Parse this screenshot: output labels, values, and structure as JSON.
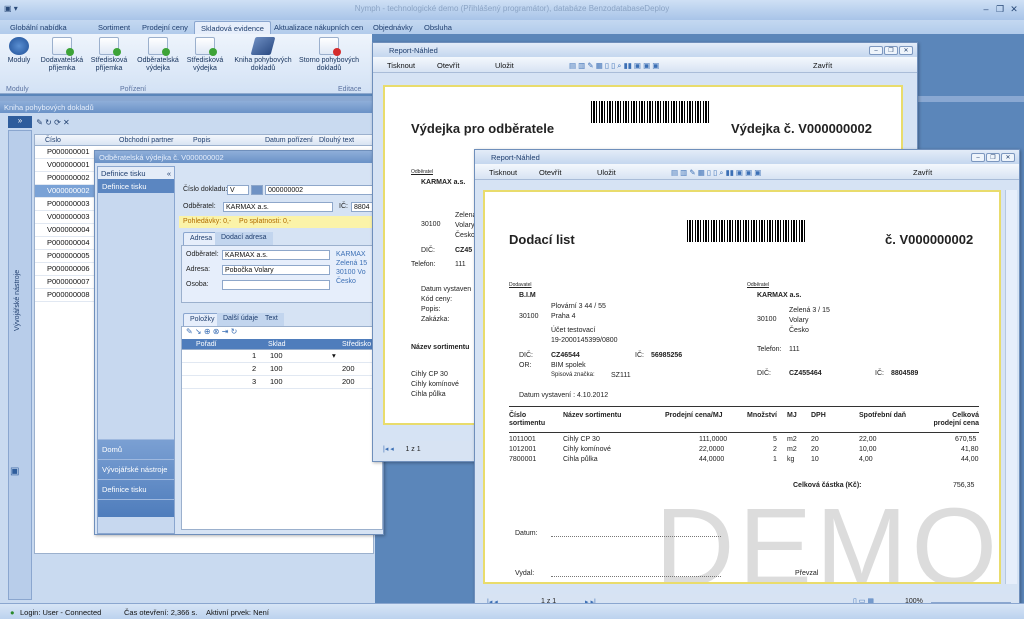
{
  "app": {
    "title": "Nymph - technologické demo (Přihlášený programátor), databáze BenzodatabaseDeploy"
  },
  "tabs": [
    "Globální nabídka",
    "Sortiment",
    "Prodejní ceny",
    "Skladová evidence",
    "Aktualizace nákupních cen",
    "Objednávky",
    "Obsluha"
  ],
  "ribbon": {
    "buttons": [
      "Moduly",
      "Dodavatelská příjemka",
      "Středisková příjemka",
      "Odběratelská výdejka",
      "Středisková výdejka",
      "Kniha pohybových dokladů",
      "Storno pohybových dokladů"
    ],
    "groups": [
      "Moduly",
      "Pořízení",
      "Editace"
    ]
  },
  "left_panel": {
    "header": "Kniha pohybových dokladů",
    "vertical_label": "Vývojářské nástroje"
  },
  "doclist": {
    "columns": [
      "Číslo",
      "Obchodní partner",
      "Popis",
      "Datum pořízení",
      "Dlouhý text"
    ],
    "rows": [
      "P000000001",
      "V000000001",
      "P000000002",
      "V000000002",
      "P000000003",
      "V000000003",
      "V000000004",
      "P000000004",
      "P000000005",
      "P000000006",
      "P000000007",
      "P000000008"
    ]
  },
  "detail": {
    "title": "Odběratelská výdejka č. V000000002",
    "nav_header": "Definice tisku",
    "nav_item": "Definice tisku",
    "cislo_label": "Číslo dokladu:",
    "cislo_prefix": "V",
    "cislo_value": "000000002",
    "odberatel_label": "Odběratel:",
    "odberatel_value": "KARMAX a.s.",
    "ic_label": "IČ:",
    "ic_value": "8804",
    "pohledavky": "Pohledávky: 0,-",
    "po_splatnosti": "Po splatnosti: 0,-",
    "subtabs": [
      "Adresa",
      "Dodací adresa"
    ],
    "adr_odberatel": "Odběratel:",
    "adr_odberatel_val": "KARMAX a.s.",
    "adr_adresa": "Adresa:",
    "adr_adresa_val": "Pobočka Volary",
    "adr_osoba": "Osoba:",
    "addr_lines": [
      "KARMAX",
      "Zelená 15",
      "30100 Vo",
      "Česko"
    ],
    "bottomtabs": [
      "Položky",
      "Další údaje",
      "Text"
    ],
    "items_cols": [
      "Pořadí",
      "Sklad",
      "Středisko"
    ],
    "items": [
      {
        "n": "1",
        "sklad": "100",
        "str": ""
      },
      {
        "n": "2",
        "sklad": "100",
        "str": "200"
      },
      {
        "n": "3",
        "sklad": "100",
        "str": "200"
      }
    ],
    "nav": [
      "Domů",
      "Vývojářské nástroje",
      "Definice tisku"
    ]
  },
  "report1": {
    "title": "Report-Náhled",
    "toolbar": [
      "Tisknout",
      "Otevřít",
      "Uložit",
      "Zavřít"
    ],
    "heading": "Výdejka pro odběratele",
    "number": "Výdejka č. V000000002",
    "odberatel_cap": "Odběratel",
    "company": "KARMAX a.s.",
    "addr": [
      "Zelená",
      "Volary",
      "Česko"
    ],
    "zip": "30100",
    "dic_label": "DIČ:",
    "dic_val": "CZ45",
    "tel_label": "Telefon:",
    "tel_val": "111",
    "labels": [
      "Datum vystaven",
      "Kód ceny:",
      "Popis:",
      "Zakázka:"
    ],
    "sort_label": "Název sortimentu",
    "items": [
      "Cihly CP 30",
      "Cihly komínové",
      "Cihla půlka"
    ],
    "page": "1 z 1"
  },
  "report2": {
    "title": "Report-Náhled",
    "toolbar": [
      "Tisknout",
      "Otevřít",
      "Uložit",
      "Zavřít"
    ],
    "heading": "Dodací list",
    "number": "č. V000000002",
    "dodavatel_cap": "Dodavatel",
    "dodavatel": "B.I.M",
    "d_addr": [
      "Plovární 3 44 / 55",
      "Praha 4"
    ],
    "d_zip": "30100",
    "d_acc": [
      "Účet testovací",
      "19-2000145399/0800"
    ],
    "d_dic_label": "DIČ:",
    "d_dic": "CZ46544",
    "d_ic_label": "IČ:",
    "d_ic": "56985256",
    "d_or_label": "OR:",
    "d_or": "BIM spolek",
    "d_spis_label": "Spisová značka:",
    "d_spis": "SZ111",
    "odberatel_cap": "Odběratel",
    "odberatel": "KARMAX a.s.",
    "o_addr": [
      "Zelená 3 / 15",
      "Volary",
      "Česko"
    ],
    "o_zip": "30100",
    "o_tel_label": "Telefon:",
    "o_tel": "111",
    "o_dic_label": "DIČ:",
    "o_dic": "CZ455464",
    "o_ic_label": "IČ:",
    "o_ic": "8804589",
    "datum": "Datum vystavení : 4.10.2012",
    "cols": [
      "Číslo sortimentu",
      "Název sortimentu",
      "Prodejní cena/MJ",
      "Množství",
      "MJ",
      "DPH",
      "Spotřební daň",
      "Celková prodejní cena"
    ],
    "rows": [
      [
        "1011001",
        "Cihly CP 30",
        "111,0000",
        "5",
        "m2",
        "20",
        "22,00",
        "670,55"
      ],
      [
        "1012001",
        "Cihly komínové",
        "22,0000",
        "2",
        "m2",
        "20",
        "10,00",
        "41,80"
      ],
      [
        "7800001",
        "Cihla půlka",
        "44,0000",
        "1",
        "kg",
        "10",
        "4,00",
        "44,00"
      ]
    ],
    "total_label": "Celková částka (Kč):",
    "total": "756,35",
    "datum_label": "Datum:",
    "vydal": "Vydal:",
    "prevzal": "Převzal",
    "watermark": "DEMO",
    "page": "1 z 1",
    "zoom": "100%"
  },
  "status": {
    "login": "Login: User - Connected",
    "cas": "Čas otevření: 2,366 s.",
    "prvek": "Aktivní prvek: Není"
  }
}
